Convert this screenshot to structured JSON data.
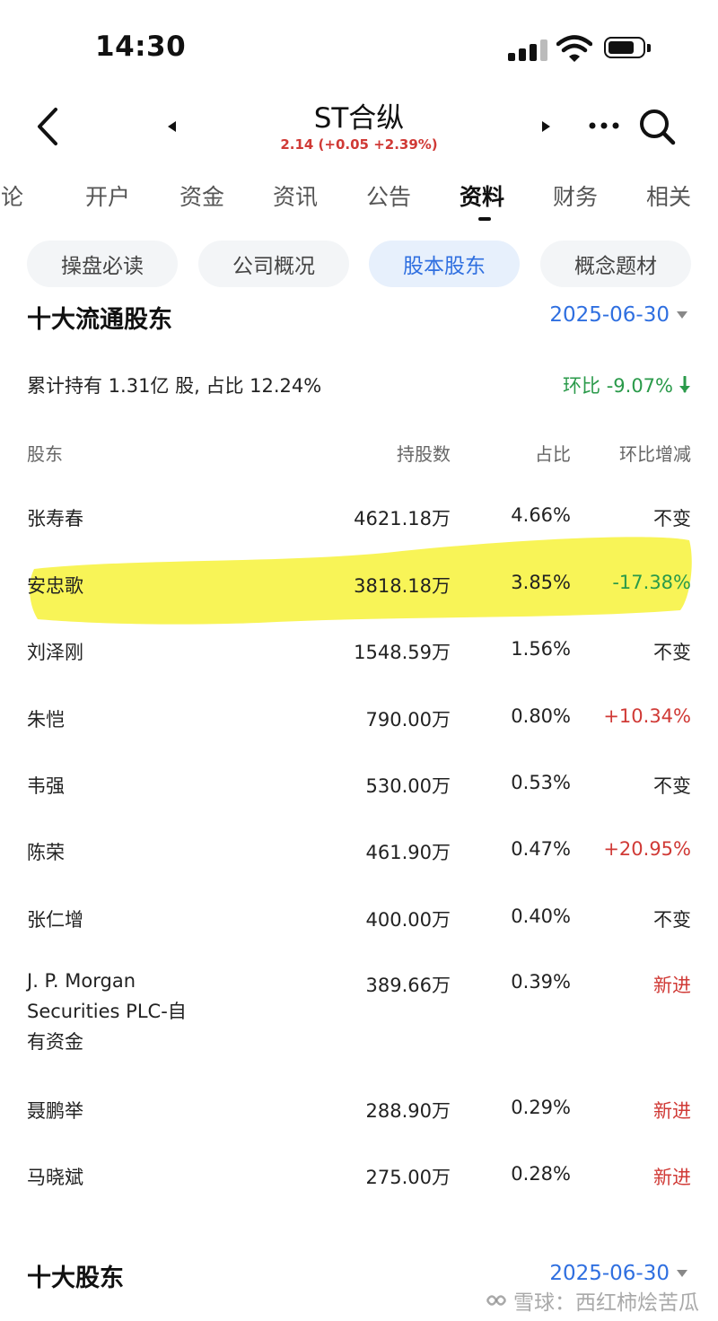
{
  "status_bar": {
    "time": "14:30"
  },
  "header": {
    "title": "ST合纵",
    "price_line": "2.14 (+0.05 +2.39%)"
  },
  "tabs": [
    {
      "label": "讨论"
    },
    {
      "label": "开户"
    },
    {
      "label": "资金"
    },
    {
      "label": "资讯"
    },
    {
      "label": "公告"
    },
    {
      "label": "资料",
      "active": true
    },
    {
      "label": "财务"
    },
    {
      "label": "相关"
    }
  ],
  "chips": [
    {
      "label": "操盘必读"
    },
    {
      "label": "公司概况"
    },
    {
      "label": "股本股东",
      "active": true
    },
    {
      "label": "概念题材"
    }
  ],
  "top10_float": {
    "title": "十大流通股东",
    "date": "2025-06-30",
    "summary": "累计持有 1.31亿 股, 占比 12.24%",
    "qoq": "环比 -9.07%",
    "columns": {
      "holder": "股东",
      "shares": "持股数",
      "ratio": "占比",
      "change": "环比增减"
    },
    "rows": [
      {
        "holder": "张寿春",
        "shares": "4621.18万",
        "ratio": "4.66%",
        "change": "不变",
        "tone": "neutral"
      },
      {
        "holder": "安忠歌",
        "shares": "3818.18万",
        "ratio": "3.85%",
        "change": "-17.38%",
        "tone": "green"
      },
      {
        "holder": "刘泽刚",
        "shares": "1548.59万",
        "ratio": "1.56%",
        "change": "不变",
        "tone": "neutral"
      },
      {
        "holder": "朱恺",
        "shares": "790.00万",
        "ratio": "0.80%",
        "change": "+10.34%",
        "tone": "red"
      },
      {
        "holder": "韦强",
        "shares": "530.00万",
        "ratio": "0.53%",
        "change": "不变",
        "tone": "neutral"
      },
      {
        "holder": "陈荣",
        "shares": "461.90万",
        "ratio": "0.47%",
        "change": "+20.95%",
        "tone": "red"
      },
      {
        "holder": "张仁增",
        "shares": "400.00万",
        "ratio": "0.40%",
        "change": "不变",
        "tone": "neutral"
      },
      {
        "holder_lines": [
          "J. P. Morgan",
          "Securities PLC-自",
          "有资金"
        ],
        "shares": "389.66万",
        "ratio": "0.39%",
        "change": "新进",
        "tone": "red"
      },
      {
        "holder": "聂鹏举",
        "shares": "288.90万",
        "ratio": "0.29%",
        "change": "新进",
        "tone": "red"
      },
      {
        "holder": "马晓斌",
        "shares": "275.00万",
        "ratio": "0.28%",
        "change": "新进",
        "tone": "red"
      }
    ]
  },
  "top10": {
    "title": "十大股东",
    "date": "2025-06-30"
  },
  "watermark": "雪球：西红柿烩苦瓜",
  "colors": {
    "accent_blue": "#2f6fe0",
    "up_red": "#d03a36",
    "down_green": "#2a9a4a",
    "highlight_yellow": "#f7f23a"
  },
  "icons": [
    "back-arrow-icon",
    "prev-stock-icon",
    "next-stock-icon",
    "more-icon",
    "search-icon",
    "down-arrow-icon",
    "caret-down-icon",
    "snowball-logo-icon"
  ]
}
